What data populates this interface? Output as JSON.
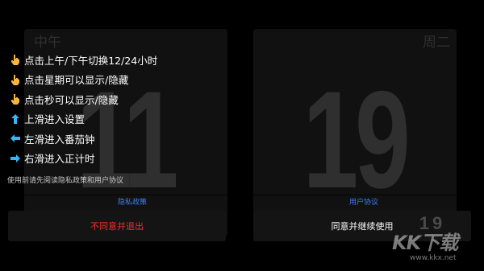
{
  "clock": {
    "period_label": "中午",
    "weekday_label": "周二",
    "hours": "11",
    "minutes": "19",
    "seconds": "19"
  },
  "hints": [
    {
      "icon": "pointing-hand-icon",
      "text": "点击上午/下午切换12/24小时"
    },
    {
      "icon": "pointing-hand-icon",
      "text": "点击星期可以显示/隐藏"
    },
    {
      "icon": "pointing-hand-icon",
      "text": "点击秒可以显示/隐藏"
    },
    {
      "icon": "arrow-up-icon",
      "text": "上滑进入设置"
    },
    {
      "icon": "arrow-left-icon",
      "text": "左滑进入番茄钟"
    },
    {
      "icon": "arrow-right-icon",
      "text": "右滑进入正计时"
    }
  ],
  "privacy_note": "使用前请先阅读隐私政策和用户协议",
  "links": {
    "privacy_policy": "隐私政策",
    "user_agreement": "用户协议"
  },
  "buttons": {
    "disagree": "不同意并退出",
    "agree": "同意并继续使用"
  },
  "watermark": {
    "logo": "KK下载",
    "url": "www.kkx.net"
  },
  "colors": {
    "background": "#000000",
    "card": "#151515",
    "digits": "#3a3a3a",
    "link": "#3d7ff2",
    "disagree": "#ff2a2a",
    "hand_icon": "#f5b53d",
    "arrow_icon": "#3db4f2"
  }
}
